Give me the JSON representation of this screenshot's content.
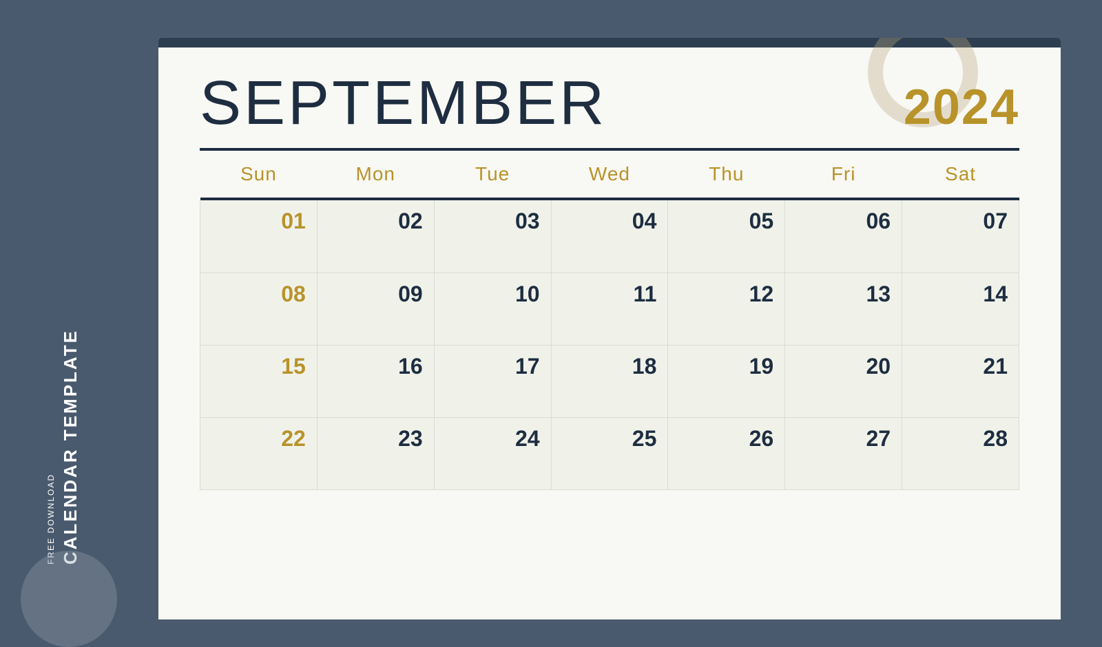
{
  "sidebar": {
    "free_download_label": "FREE DOWNLOAD",
    "calendar_template_label": "CALENDAR TEMPLATE"
  },
  "calendar": {
    "month": "SEPTEMBER",
    "year": "2024",
    "days_of_week": [
      {
        "label": "Sun",
        "type": "weekend"
      },
      {
        "label": "Mon",
        "type": "weekday"
      },
      {
        "label": "Tue",
        "type": "weekday"
      },
      {
        "label": "Wed",
        "type": "weekday"
      },
      {
        "label": "Thu",
        "type": "weekday"
      },
      {
        "label": "Fri",
        "type": "weekday"
      },
      {
        "label": "Sat",
        "type": "weekend"
      }
    ],
    "weeks": [
      [
        {
          "day": "01",
          "type": "sunday"
        },
        {
          "day": "02",
          "type": "weekday"
        },
        {
          "day": "03",
          "type": "weekday"
        },
        {
          "day": "04",
          "type": "weekday"
        },
        {
          "day": "05",
          "type": "weekday"
        },
        {
          "day": "06",
          "type": "weekday"
        },
        {
          "day": "07",
          "type": "weekday"
        }
      ],
      [
        {
          "day": "08",
          "type": "sunday"
        },
        {
          "day": "09",
          "type": "weekday"
        },
        {
          "day": "10",
          "type": "weekday"
        },
        {
          "day": "11",
          "type": "weekday"
        },
        {
          "day": "12",
          "type": "weekday"
        },
        {
          "day": "13",
          "type": "weekday"
        },
        {
          "day": "14",
          "type": "weekday"
        }
      ],
      [
        {
          "day": "15",
          "type": "sunday"
        },
        {
          "day": "16",
          "type": "weekday"
        },
        {
          "day": "17",
          "type": "weekday"
        },
        {
          "day": "18",
          "type": "weekday"
        },
        {
          "day": "19",
          "type": "weekday"
        },
        {
          "day": "20",
          "type": "weekday"
        },
        {
          "day": "21",
          "type": "weekday"
        }
      ],
      [
        {
          "day": "22",
          "type": "sunday"
        },
        {
          "day": "23",
          "type": "weekday"
        },
        {
          "day": "24",
          "type": "weekday"
        },
        {
          "day": "25",
          "type": "weekday"
        },
        {
          "day": "26",
          "type": "weekday"
        },
        {
          "day": "27",
          "type": "weekday"
        },
        {
          "day": "28",
          "type": "weekday"
        }
      ]
    ]
  },
  "colors": {
    "background": "#4a5a6e",
    "calendar_bg": "#f8f8f4",
    "top_bar": "#1e2d40",
    "month_color": "#1e2d40",
    "year_color": "#b8932a",
    "day_header_color": "#b8932a",
    "day_number_color": "#1e2d40",
    "sunday_color": "#b8932a",
    "cell_bg": "#f0f2ea",
    "cell_border": "#d8ddd0"
  }
}
